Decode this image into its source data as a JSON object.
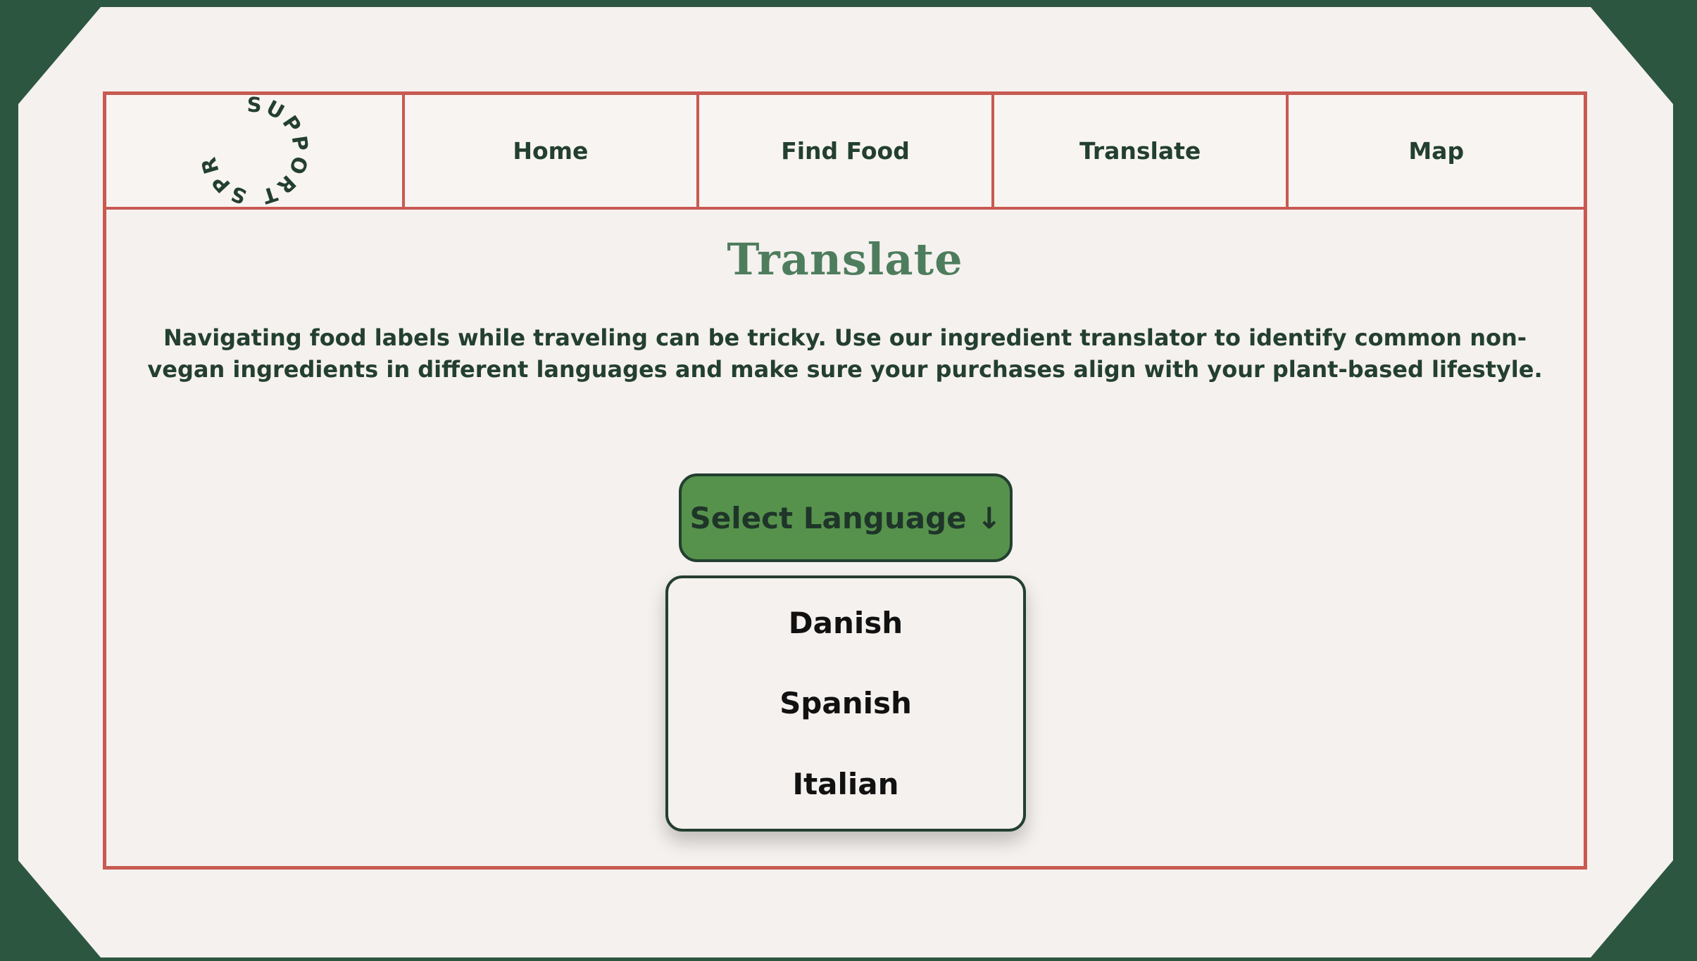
{
  "logo": {
    "text": "SUPPORT SPROUT",
    "color": "#233f30"
  },
  "nav": {
    "items": [
      {
        "label": "Home"
      },
      {
        "label": "Find Food"
      },
      {
        "label": "Translate"
      },
      {
        "label": "Map"
      }
    ]
  },
  "main": {
    "title": "Translate",
    "description": "Navigating food labels while traveling can be tricky. Use our ingredient translator to identify common non-vegan ingredients in different languages and make sure your purchases align with your plant-based lifestyle.",
    "select_button_label": "Select Language ↓",
    "dropdown": {
      "options": [
        {
          "label": "Danish"
        },
        {
          "label": "Spanish"
        },
        {
          "label": "Italian"
        }
      ]
    }
  },
  "colors": {
    "background_dark": "#2d5640",
    "card": "#f5f1ef",
    "border_accent": "#c85a52",
    "title_green": "#4e7d5d",
    "button_green": "#56924c",
    "text_dark": "#233f30"
  }
}
